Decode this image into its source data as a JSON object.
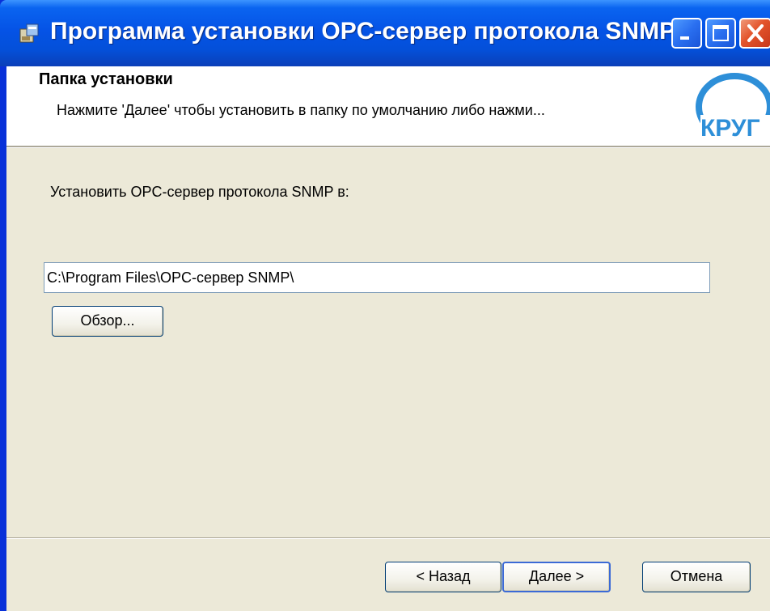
{
  "window": {
    "title": "Программа установки OPC-сервер протокола SNMP",
    "controls": [
      "minimize",
      "maximize",
      "close"
    ]
  },
  "banner": {
    "title": "Папка установки",
    "description": "Нажмите 'Далее' чтобы установить в папку по умолчанию либо нажми...",
    "logo_text": "КРУГ"
  },
  "main": {
    "install_label": "Установить OPC-сервер протокола SNMP в:",
    "path_value": "C:\\Program Files\\OPC-сервер SNMP\\",
    "browse_label": "Обзор..."
  },
  "footer": {
    "back_label": "< Назад",
    "next_label": "Далее >",
    "cancel_label": "Отмена"
  },
  "colors": {
    "titlebar": "#0553e6",
    "client_bg": "#ece9d8",
    "logo": "#2e8fd8",
    "close_button": "#e3542b"
  }
}
